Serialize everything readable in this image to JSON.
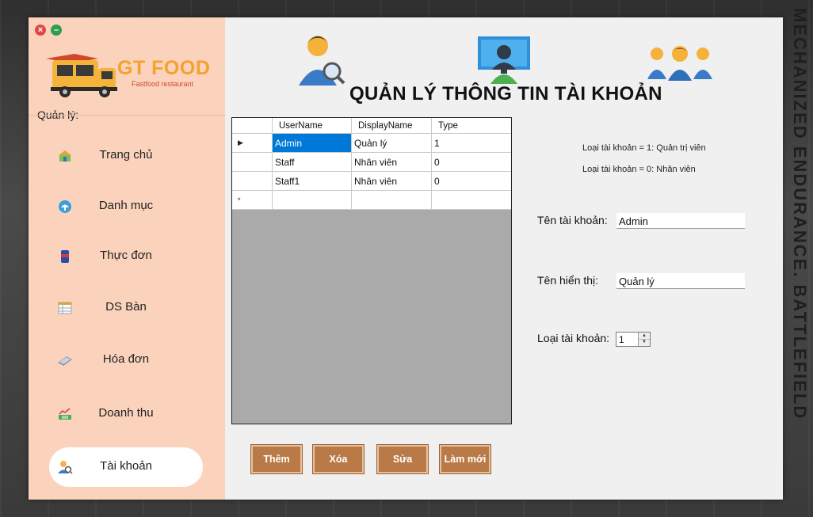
{
  "background_text": "MECHANIZED ENDURANCE. BATTLEFIELD",
  "window": {
    "close_glyph": "×",
    "minimize_glyph": "–"
  },
  "sidebar": {
    "logo_title": "GT FOOD",
    "logo_subtitle": "Fastfood restaurant",
    "section_label": "Quản lý:",
    "items": [
      {
        "label": "Trang chủ",
        "icon": "home-icon",
        "active": false
      },
      {
        "label": "Danh mục",
        "icon": "category-icon",
        "active": false
      },
      {
        "label": "Thực đơn",
        "icon": "drink-can-icon",
        "active": false
      },
      {
        "label": "DS Bàn",
        "icon": "table-list-icon",
        "active": false
      },
      {
        "label": "Hóa đơn",
        "icon": "bill-icon",
        "active": false
      },
      {
        "label": "Doanh thu",
        "icon": "revenue-chart-icon",
        "active": false
      },
      {
        "label": "Tài khoản",
        "icon": "account-search-icon",
        "active": true
      }
    ],
    "colors": {
      "background": "#fbd3bd",
      "active_item": "#ffffff",
      "logo_orange": "#f4a12f"
    }
  },
  "main": {
    "title": "QUẢN LÝ THÔNG TIN TÀI KHOẢN",
    "header_icons": [
      "user-search-icon",
      "monitor-user-icon",
      "user-group-icon"
    ],
    "grid": {
      "columns": [
        "UserName",
        "DisplayName",
        "Type"
      ],
      "rows": [
        {
          "marker": "▶",
          "cells": [
            "Admin",
            "Quản lý",
            "1"
          ]
        },
        {
          "marker": "",
          "cells": [
            "Staff",
            "Nhân viên",
            "0"
          ]
        },
        {
          "marker": "",
          "cells": [
            "Staff1",
            "Nhân viên",
            "0"
          ]
        },
        {
          "marker": "*",
          "cells": [
            "",
            "",
            ""
          ]
        }
      ],
      "selected_row": 0,
      "selected_column": 0
    },
    "info_lines": [
      "Loại tài khoản = 1: Quản trị viên",
      "Loại tài khoản = 0: Nhân viên"
    ],
    "form": {
      "username_label": "Tên tài khoản:",
      "username_value": "Admin",
      "display_label": "Tên hiển thị:",
      "display_value": "Quản lý",
      "type_label": "Loại tài khoản:",
      "type_value": "1"
    },
    "buttons": {
      "add": "Thêm",
      "delete": "Xóa",
      "edit": "Sửa",
      "refresh": "Làm mới"
    },
    "colors": {
      "button": "#b97a47",
      "selection": "#0078d7",
      "grid_empty": "#aaaaaa"
    }
  }
}
